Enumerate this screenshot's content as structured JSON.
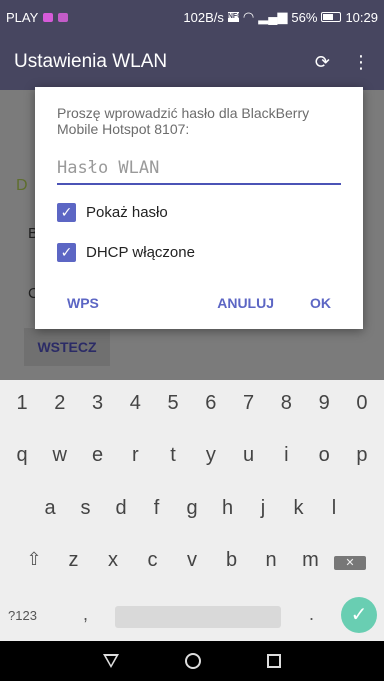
{
  "status": {
    "carrier": "PLAY",
    "speed": "102B/s",
    "battery": "56%",
    "time": "10:29",
    "nfc": "NFC"
  },
  "appbar": {
    "title": "Ustawienia WLAN"
  },
  "background": {
    "section_letter": "D",
    "row1_letter": "B",
    "row2_letter": "C",
    "back_label": "WSTECZ"
  },
  "dialog": {
    "prompt": "Proszę wprowadzić hasło dla BlackBerry Mobile Hotspot 8107:",
    "password_placeholder": "Hasło WLAN",
    "show_password_label": "Pokaż hasło",
    "dhcp_label": "DHCP włączone",
    "wps_label": "WPS",
    "cancel_label": "ANULUJ",
    "ok_label": "OK"
  },
  "keyboard": {
    "numbers": [
      "1",
      "2",
      "3",
      "4",
      "5",
      "6",
      "7",
      "8",
      "9",
      "0"
    ],
    "row1": [
      "q",
      "w",
      "e",
      "r",
      "t",
      "y",
      "u",
      "i",
      "o",
      "p"
    ],
    "row2": [
      "a",
      "s",
      "d",
      "f",
      "g",
      "h",
      "j",
      "k",
      "l"
    ],
    "row3": [
      "z",
      "x",
      "c",
      "v",
      "b",
      "n",
      "m"
    ],
    "sym_label": "?123",
    "comma": ",",
    "period": "."
  },
  "colors": {
    "bar": "#474660",
    "accent": "#5c66c4",
    "enter": "#69ceb2"
  }
}
